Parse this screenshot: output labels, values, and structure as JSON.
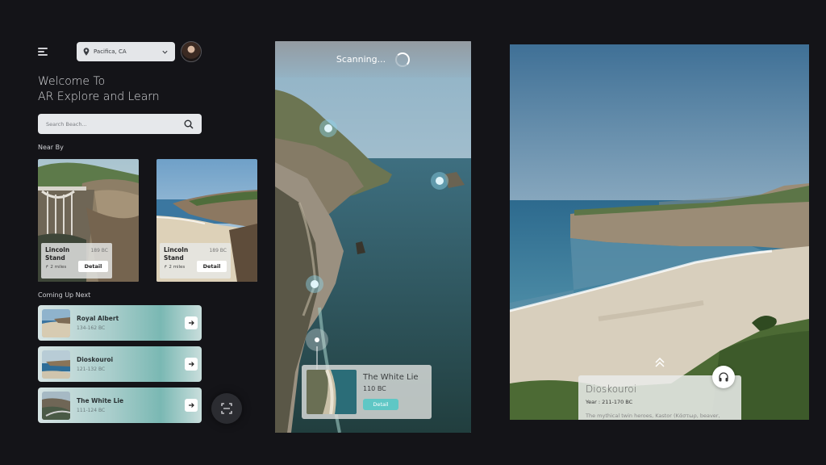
{
  "header": {
    "location": "Pacifica, CA",
    "welcome_line1": "Welcome To",
    "welcome_line2": "AR Explore and Learn"
  },
  "search": {
    "placeholder": "Search Beach..."
  },
  "near_by": {
    "label": "Near By",
    "cards": [
      {
        "name": "Lincoln Stand",
        "year": "189 BC",
        "distance": "2 miles",
        "button": "Detail"
      },
      {
        "name": "Lincoln Stand",
        "year": "189 BC",
        "distance": "2 miles",
        "button": "Detail"
      }
    ]
  },
  "coming_up": {
    "label": "Coming Up Next",
    "items": [
      {
        "title": "Royal Albert",
        "years": "134-162 BC"
      },
      {
        "title": "Dioskouroi",
        "years": "121-132 BC"
      },
      {
        "title": "The White Lie",
        "years": "111-124 BC"
      }
    ]
  },
  "ar_view": {
    "status": "Scanning...",
    "card": {
      "title": "The White Lie",
      "year": "110 BC",
      "button": "Detail"
    }
  },
  "detail_view": {
    "title": "Dioskouroi",
    "year": "Year : 211-170 BC",
    "description": "The mythical twin heroes, Kastor (Κάστωρ, beaver,"
  },
  "colors": {
    "accent": "#5fc7c5",
    "background": "#141418",
    "card_teal": "#7ab8b3"
  },
  "icons": [
    "menu-icon",
    "pin-icon",
    "chevron-down-icon",
    "search-icon",
    "arrow-right-icon",
    "scan-icon",
    "headphones-icon",
    "double-chevron-up-icon"
  ]
}
